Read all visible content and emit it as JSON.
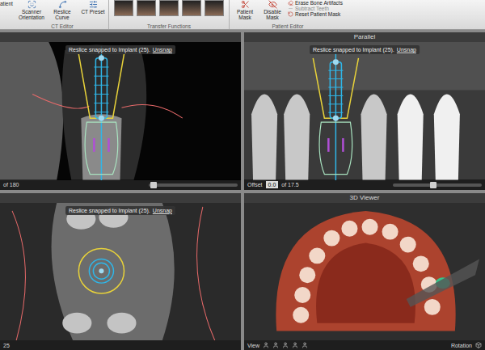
{
  "toolbar": {
    "cut_label": "atient",
    "ct_editor": {
      "label": "CT Editor",
      "buttons": [
        "Scanner Orientation",
        "Reslice Curve",
        "CT Preset"
      ]
    },
    "transfer_functions": {
      "label": "Transfer Functions",
      "thumbnails": [
        {
          "selected": false
        },
        {
          "selected": false
        },
        {
          "selected": false
        },
        {
          "selected": false
        },
        {
          "selected": false
        }
      ]
    },
    "patient_editor": {
      "label": "Patient Editor",
      "buttons": [
        "Patient Mask",
        "Disable Mask"
      ],
      "actions": [
        {
          "label": "Erase Bone Artifacts",
          "disabled": false
        },
        {
          "label": "Subtract Teeth",
          "disabled": true
        },
        {
          "label": "Reset Patient Mask",
          "disabled": false
        }
      ]
    }
  },
  "panels": [
    {
      "kind": "cross-section",
      "title": "",
      "badge": {
        "text": "Reslice snapped to Implant (25).",
        "link": "Unsnap"
      },
      "footer": {
        "text": "of 180",
        "level": 0.05
      }
    },
    {
      "kind": "parallel",
      "title": "Parallel",
      "badge": {
        "text": "Reslice snapped to Implant (25).",
        "link": "Unsnap"
      },
      "footer": {
        "label": "Offset",
        "value": "0.0",
        "text": "of 17.5",
        "level": 0.45
      }
    },
    {
      "kind": "axial",
      "title": "",
      "badge": {
        "text": "Reslice snapped to Implant (25).",
        "link": "Unsnap"
      },
      "footer": {
        "text": "25"
      }
    },
    {
      "kind": "3d",
      "title": "3D Viewer",
      "footer": {
        "label": "View",
        "right": "Rotation"
      }
    }
  ]
}
